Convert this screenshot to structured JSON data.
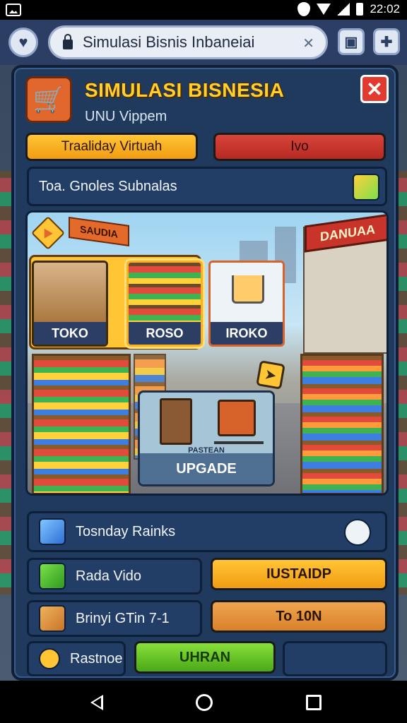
{
  "status": {
    "time": "22:02"
  },
  "browser": {
    "url_title": "Simulasi Bisnis Inbaneiai"
  },
  "header": {
    "title": "SIMULASI BISNESIA",
    "subtitle": "UNU Vippem"
  },
  "top_buttons": {
    "primary": "Traaliday Virtuah",
    "secondary": "Ivo"
  },
  "section_bar": {
    "label": "Toa. Gnoles Subnalas"
  },
  "store": {
    "left_sign": "SAUDIA",
    "right_sign": "DANUAA",
    "cards": [
      {
        "label": "TOKO"
      },
      {
        "label": "ROSO"
      },
      {
        "label": "IROKO"
      }
    ],
    "upgrade": {
      "small_text": "PASTEAN",
      "label": "UPGADE"
    }
  },
  "rows": {
    "ranks": {
      "label": "Tosnday Rainks"
    },
    "video": {
      "label": "Rada Vido",
      "button": "IUSTAIDP"
    },
    "brinyi": {
      "label": "Brinyi GTin 7-1",
      "button": "To 10N"
    },
    "rastnoe": {
      "label": "Rastnoe",
      "button": "UHRAN"
    }
  },
  "colors": {
    "accent": "#ffc535",
    "danger": "#e23a2e",
    "panel": "#203a5e",
    "success": "#4aa817"
  }
}
